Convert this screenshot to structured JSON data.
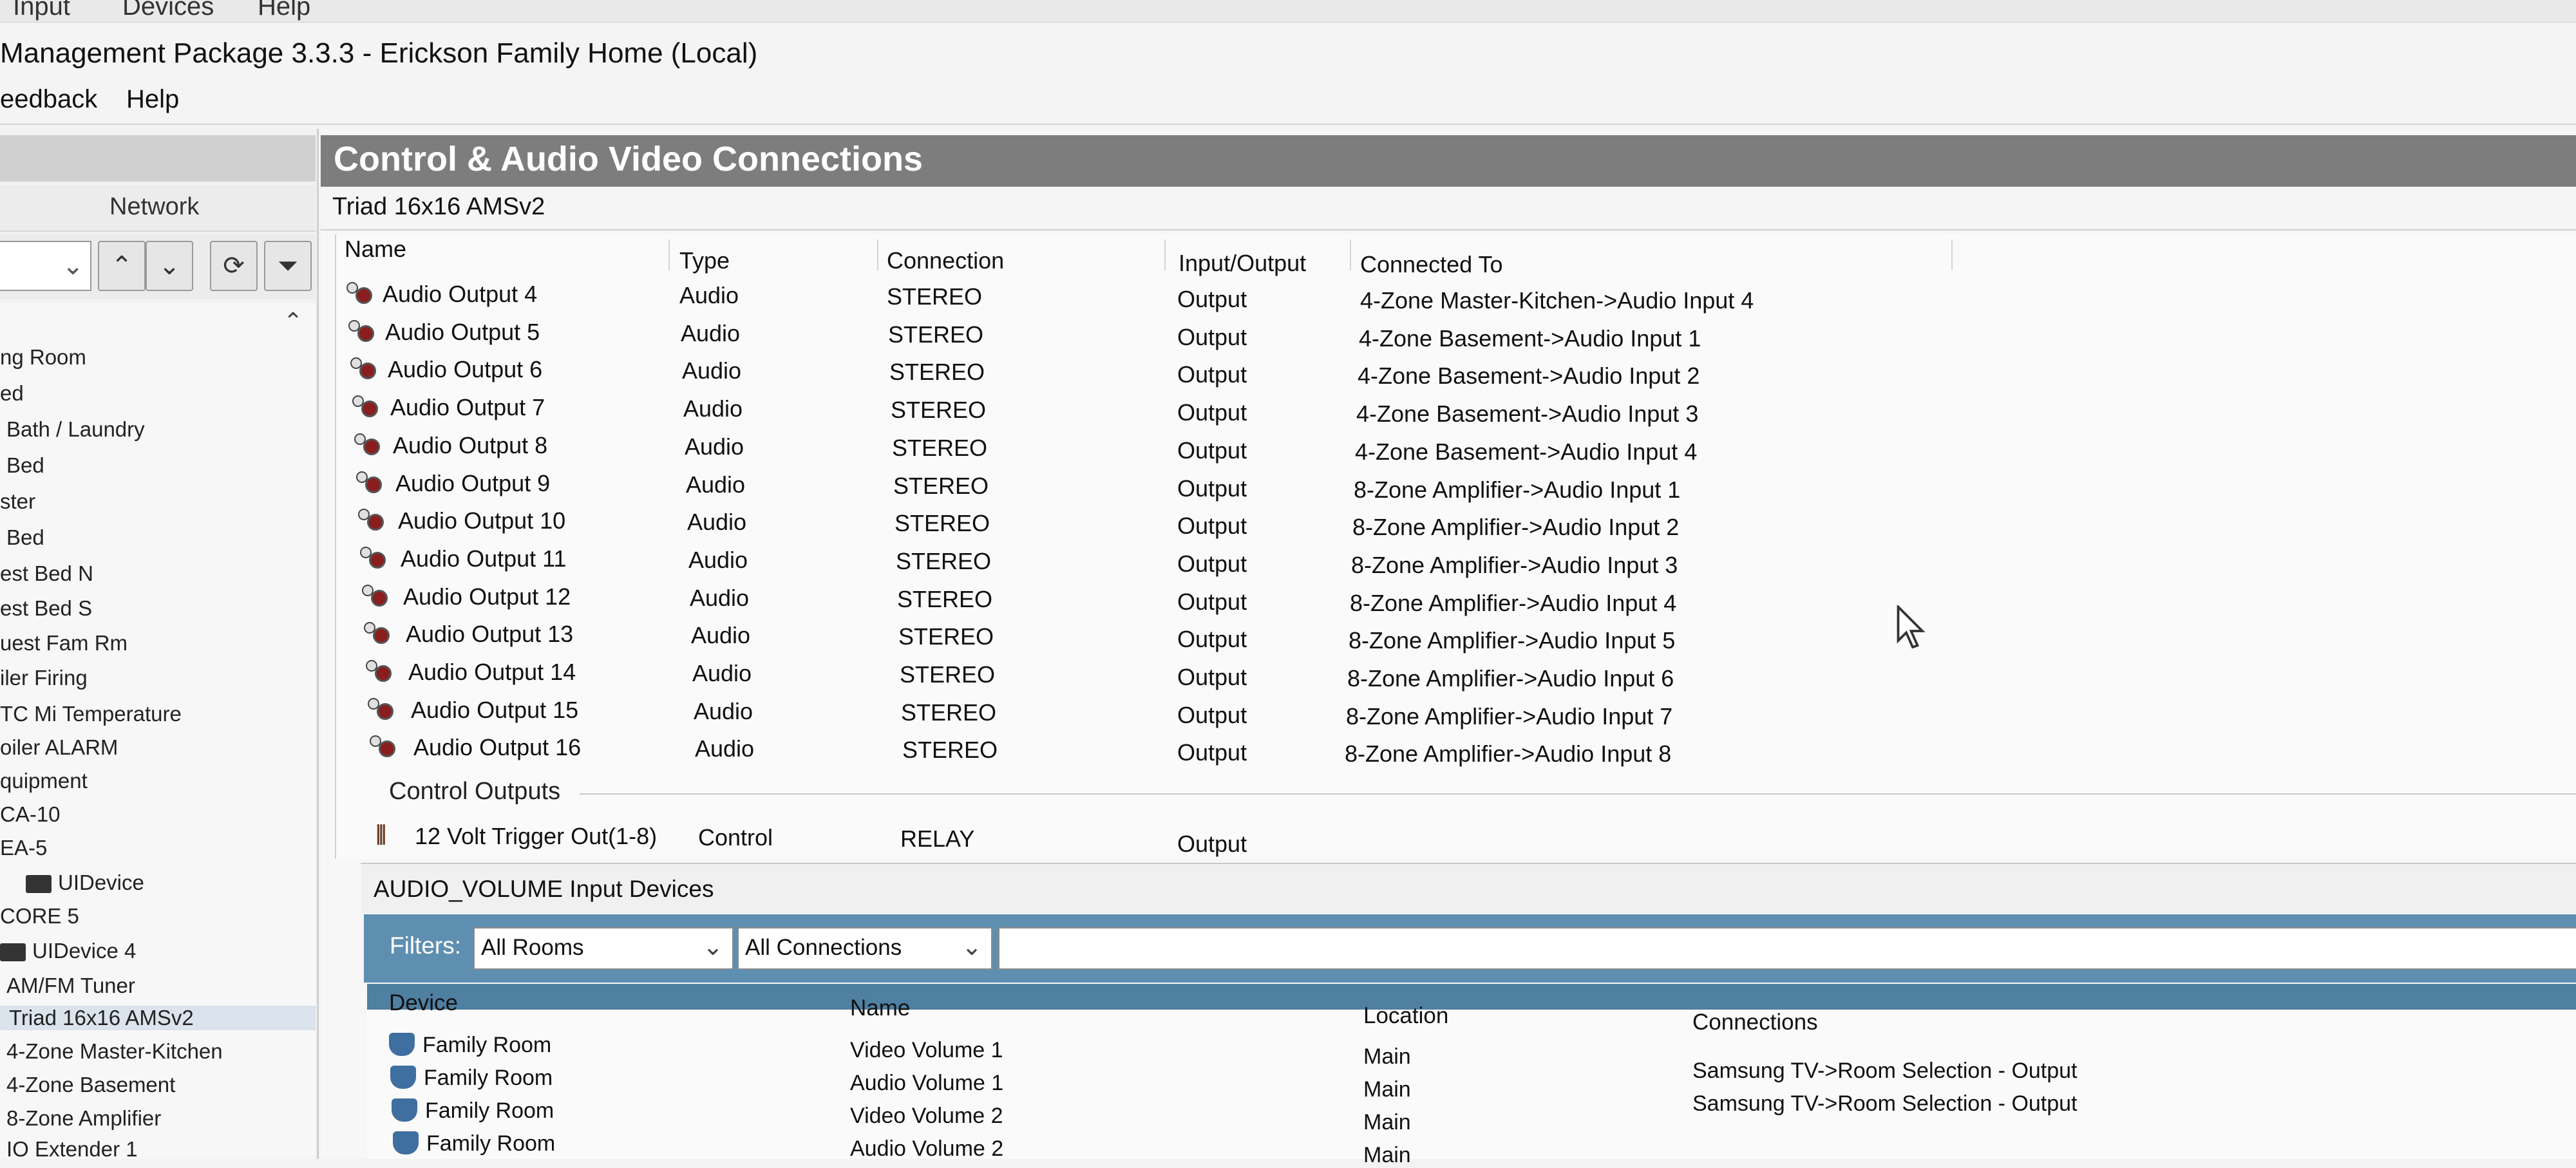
{
  "menubar_top": [
    "Input",
    "Devices",
    "Help"
  ],
  "window_title": "Management Package 3.3.3 - Erickson Family Home (Local)",
  "menubar": [
    "eedback",
    "Help"
  ],
  "sidebar": {
    "network_label": "Network",
    "items": [
      "ng Room",
      "ed",
      "Bath / Laundry",
      "Bed",
      "ster",
      "Bed",
      "est Bed N",
      "est Bed S",
      "uest Fam Rm",
      "iler Firing",
      "TC Mi Temperature",
      "oiler ALARM",
      "quipment",
      "CA-10",
      "EA-5",
      "UIDevice",
      "CORE 5",
      "UIDevice 4",
      "AM/FM Tuner",
      "Triad 16x16 AMSv2",
      "4-Zone Master-Kitchen",
      "4-Zone Basement",
      "8-Zone Amplifier",
      "IO Extender 1"
    ]
  },
  "panel": {
    "title": "Control & Audio Video Connections",
    "device": "Triad 16x16 AMSv2",
    "columns": [
      "Name",
      "Type",
      "Connection",
      "Input/Output",
      "Connected To"
    ],
    "rows": [
      {
        "name": "Audio Output 4",
        "type": "Audio",
        "connection": "STEREO",
        "io": "Output",
        "to": "4-Zone Master-Kitchen->Audio Input 4"
      },
      {
        "name": "Audio Output 5",
        "type": "Audio",
        "connection": "STEREO",
        "io": "Output",
        "to": "4-Zone Basement->Audio Input 1"
      },
      {
        "name": "Audio Output 6",
        "type": "Audio",
        "connection": "STEREO",
        "io": "Output",
        "to": "4-Zone Basement->Audio Input 2"
      },
      {
        "name": "Audio Output 7",
        "type": "Audio",
        "connection": "STEREO",
        "io": "Output",
        "to": "4-Zone Basement->Audio Input 3"
      },
      {
        "name": "Audio Output 8",
        "type": "Audio",
        "connection": "STEREO",
        "io": "Output",
        "to": "4-Zone Basement->Audio Input 4"
      },
      {
        "name": "Audio Output 9",
        "type": "Audio",
        "connection": "STEREO",
        "io": "Output",
        "to": "8-Zone Amplifier->Audio Input 1"
      },
      {
        "name": "Audio Output 10",
        "type": "Audio",
        "connection": "STEREO",
        "io": "Output",
        "to": "8-Zone Amplifier->Audio Input 2"
      },
      {
        "name": "Audio Output 11",
        "type": "Audio",
        "connection": "STEREO",
        "io": "Output",
        "to": "8-Zone Amplifier->Audio Input 3"
      },
      {
        "name": "Audio Output 12",
        "type": "Audio",
        "connection": "STEREO",
        "io": "Output",
        "to": "8-Zone Amplifier->Audio Input 4"
      },
      {
        "name": "Audio Output 13",
        "type": "Audio",
        "connection": "STEREO",
        "io": "Output",
        "to": "8-Zone Amplifier->Audio Input 5"
      },
      {
        "name": "Audio Output 14",
        "type": "Audio",
        "connection": "STEREO",
        "io": "Output",
        "to": "8-Zone Amplifier->Audio Input 6"
      },
      {
        "name": "Audio Output 15",
        "type": "Audio",
        "connection": "STEREO",
        "io": "Output",
        "to": "8-Zone Amplifier->Audio Input 7"
      },
      {
        "name": "Audio Output 16",
        "type": "Audio",
        "connection": "STEREO",
        "io": "Output",
        "to": "8-Zone Amplifier->Audio Input 8"
      }
    ],
    "control_section": "Control Outputs",
    "control_row": {
      "name": "12 Volt Trigger Out(1-8)",
      "type": "Control",
      "connection": "RELAY",
      "io": "Output"
    }
  },
  "audio_volume": {
    "title": "AUDIO_VOLUME Input Devices",
    "filters_label": "Filters:",
    "rooms_filter": "All Rooms",
    "connections_filter": "All Connections",
    "search_value": "",
    "columns": [
      "Device",
      "Name",
      "Location",
      "Connections"
    ],
    "rows": [
      {
        "device": "Family Room",
        "name": "Video Volume 1",
        "location": "Main",
        "connections": "Samsung TV->Room Selection - Output"
      },
      {
        "device": "Family Room",
        "name": "Audio Volume 1",
        "location": "Main",
        "connections": "Samsung TV->Room Selection - Output"
      },
      {
        "device": "Family Room",
        "name": "Video Volume 2",
        "location": "Main",
        "connections": ""
      },
      {
        "device": "Family Room",
        "name": "Audio Volume 2",
        "location": "Main",
        "connections": ""
      }
    ]
  },
  "colors": {
    "panel_header": "#7d7d7d",
    "filter_bar": "#5f8fb0",
    "device_icon": "#3f6fa0",
    "connector_dot": "#8a1e1e"
  }
}
